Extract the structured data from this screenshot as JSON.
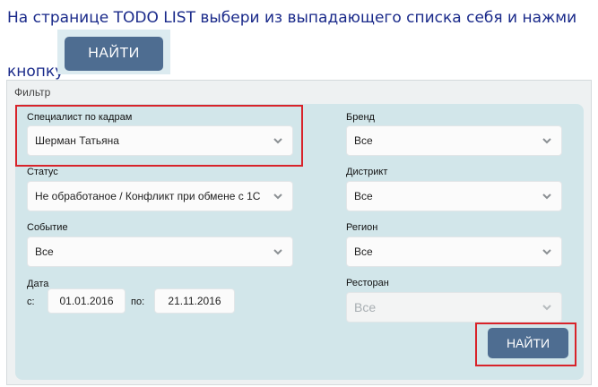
{
  "instruction": {
    "line1": "На странице TODO LIST выбери из выпадающего списка себя и нажми",
    "line2": "кнопку",
    "button_label": "НАЙТИ"
  },
  "filter": {
    "title": "Фильтр",
    "specialist": {
      "label": "Специалист по кадрам",
      "value": "Шерман Татьяна"
    },
    "status": {
      "label": "Статус",
      "value": "Не обработаное / Конфликт при обмене с 1С"
    },
    "event": {
      "label": "Событие",
      "value": "Все"
    },
    "date": {
      "label": "Дата",
      "from_label": "с:",
      "from": "01.01.2016",
      "to_label": "по:",
      "to": "21.11.2016"
    },
    "brand": {
      "label": "Бренд",
      "value": "Все"
    },
    "district": {
      "label": "Дистрикт",
      "value": "Все"
    },
    "region": {
      "label": "Регион",
      "value": "Все"
    },
    "restaurant": {
      "label": "Ресторан",
      "value": "Все"
    },
    "find_button": "НАЙТИ"
  },
  "colors": {
    "button": "#4e6d91",
    "highlight": "#d8232a",
    "panel_inner": "#d2e6ea"
  }
}
